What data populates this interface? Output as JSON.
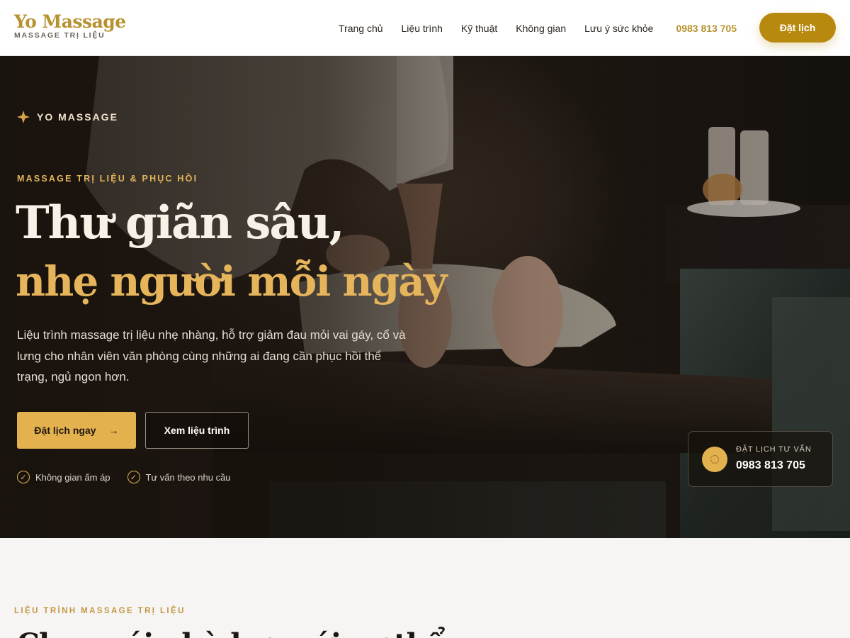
{
  "brand": {
    "name": "Yo Massage",
    "tagline": "MASSAGE TRỊ LIỆU"
  },
  "nav": {
    "items": [
      "Trang chủ",
      "Liệu trình",
      "Kỹ thuật",
      "Không gian",
      "Lưu ý sức khỏe"
    ],
    "phone": "0983 813 705",
    "cta": "Đặt lịch"
  },
  "hero": {
    "eyebrow": "YO MASSAGE",
    "kicker": "MASSAGE TRỊ LIỆU & PHỤC HỒI",
    "title_line1": "Thư giãn sâu,",
    "title_line2": "nhẹ người mỗi ngày",
    "description": "Liệu trình massage trị liệu nhẹ nhàng, hỗ trợ giảm đau mỏi vai gáy, cổ và lưng cho nhân viên văn phòng cùng những ai đang cần phục hồi thể trạng, ngủ ngon hơn.",
    "primary_button": "Đặt lịch ngay",
    "primary_arrow": "→",
    "secondary_button": "Xem liệu trình",
    "checks": [
      "Không gian ấm áp",
      "Tư vấn theo nhu cầu"
    ]
  },
  "consult_card": {
    "label": "ĐẶT LỊCH TƯ VẤN",
    "phone": "0983 813 705"
  },
  "section": {
    "kicker": "LIỆU TRÌNH MASSAGE TRỊ LIỆU",
    "heading": "Chọn gói phù hợp với cơ thể"
  },
  "colors": {
    "accent": "#b8890f",
    "gold_text": "#e6b55b",
    "hero_dark": "#1b140e",
    "page_bg": "#f6f5f3"
  },
  "icons": {
    "eyebrow": "sparkle-icon",
    "check": "check-circle-icon",
    "consult": "phone-ring-icon"
  }
}
